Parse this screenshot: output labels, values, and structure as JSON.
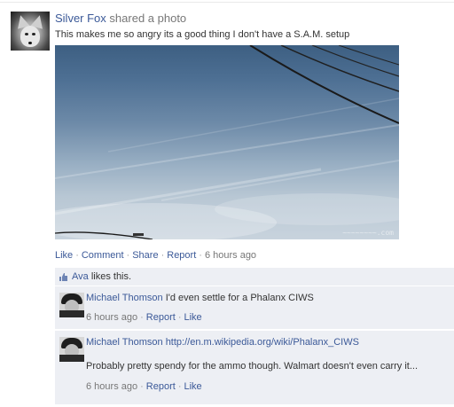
{
  "post": {
    "author": "Silver Fox",
    "action": "shared a photo",
    "caption": "This makes me so angry its a good thing I don't have a S.A.M. setup",
    "watermark": "~~~~~~~~.com"
  },
  "actions": {
    "like": "Like",
    "comment": "Comment",
    "share": "Share",
    "report": "Report",
    "time": "6 hours ago",
    "separator": "·"
  },
  "likes": {
    "name": "Ava",
    "text": " likes this."
  },
  "comments": [
    {
      "author": "Michael Thomson",
      "text": "I'd even settle for a Phalanx CIWS",
      "time": "6 hours ago",
      "report": "Report",
      "like": "Like"
    },
    {
      "author": "Michael Thomson",
      "url": "http://en.m.wikipedia.org/wiki/Phalanx_CIWS",
      "text": "Probably pretty spendy for the ammo though. Walmart doesn't even carry it...",
      "time": "6 hours ago",
      "report": "Report",
      "like": "Like"
    }
  ],
  "icons": {
    "avatar": "fox-avatar",
    "likes": "thumbs-up-icon"
  }
}
